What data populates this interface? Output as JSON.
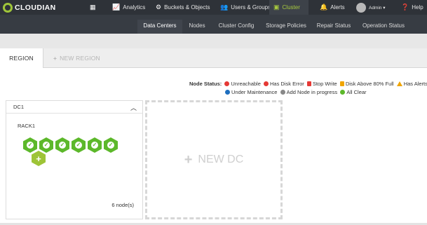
{
  "topbar": {
    "brand": "CLOUDIAN",
    "nav": [
      {
        "label": "",
        "icon": "grid-icon"
      },
      {
        "label": "Analytics",
        "icon": "chart-icon"
      },
      {
        "label": "Buckets & Objects",
        "icon": "gear-icon"
      },
      {
        "label": "Users & Groups",
        "icon": "users-icon"
      },
      {
        "label": "Cluster",
        "icon": "cluster-icon",
        "active": true
      },
      {
        "label": "Alerts",
        "icon": "bell-icon"
      },
      {
        "label": "Admin ▾",
        "icon": "avatar"
      },
      {
        "label": "Help",
        "icon": "help-icon"
      }
    ]
  },
  "subnav": [
    {
      "label": "Data Centers",
      "active": true
    },
    {
      "label": "Nodes"
    },
    {
      "label": "Cluster Config"
    },
    {
      "label": "Storage Policies"
    },
    {
      "label": "Repair Status"
    },
    {
      "label": "Operation Status"
    }
  ],
  "tabs": {
    "region": "REGION",
    "new_region": "NEW REGION"
  },
  "legend": {
    "title": "Node Status:",
    "unreachable": "Unreachable",
    "disk_error": "Has Disk Error",
    "stop_write": "Stop Write",
    "disk_above": "Disk Above 80% Full",
    "alerts": "Has Alerts",
    "maintenance": "Under Maintenance",
    "add_node": "Add Node in progress",
    "all_clear": "All Clear"
  },
  "dc": {
    "name": "DC1",
    "rack": "RACK1",
    "node_count": "6 node(s)",
    "nodes": 6
  },
  "new_dc": "NEW DC",
  "colors": {
    "accent": "#a9cb3e",
    "node_ok": "#5cb82a",
    "add_node": "#9ec437",
    "error": "#e53935",
    "warning": "#f0a500",
    "maintenance": "#1e6fbf"
  }
}
